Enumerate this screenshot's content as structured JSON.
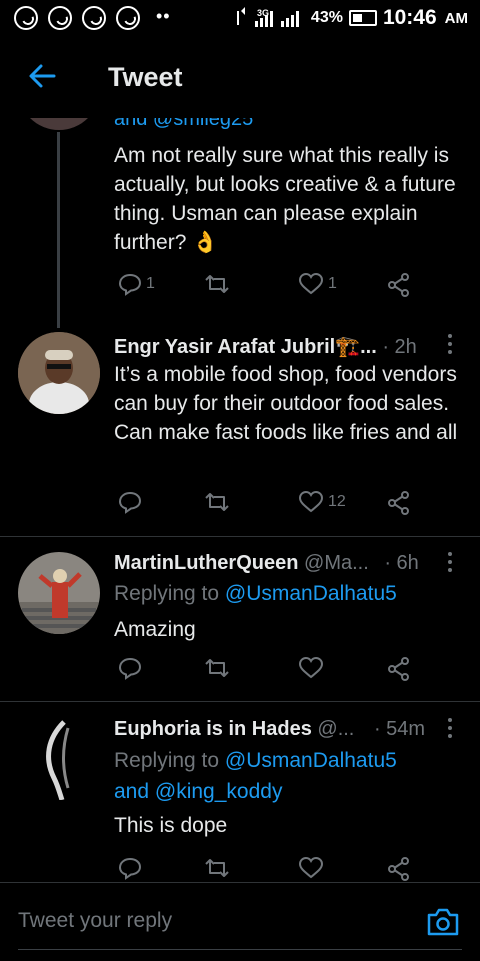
{
  "status_bar": {
    "battery_percent": "43%",
    "time": "10:46",
    "ampm": "AM",
    "overflow": "••",
    "network": "3G"
  },
  "header": {
    "title": "Tweet"
  },
  "tweets": [
    {
      "reply_partial": "and @smileg25",
      "text": "Am not really sure what this really is actually, but looks creative & a future thing. Usman can please explain further? 👌",
      "replies": "1",
      "likes": "1"
    },
    {
      "name": "Engr Yasir Arafat Jubril🏗️...",
      "time": "· 2h",
      "text": "It’s a mobile food shop, food vendors can buy for their outdoor food sales. Can make fast foods like fries and all",
      "replies": "",
      "likes": "12"
    },
    {
      "name": "MartinLutherQueen",
      "handle": "@Ma...",
      "time": "· 6h",
      "replying_label": "Replying to",
      "replying_to": "@UsmanDalhatu5",
      "text": "Amazing",
      "likes": ""
    },
    {
      "name": "Euphoria is in Hades",
      "handle": "@...",
      "time": "· 54m",
      "replying_label": "Replying to",
      "replying_to": "@UsmanDalhatu5",
      "replying_and": "and",
      "replying_to_2": "@king_koddy",
      "text": "This is dope",
      "likes": ""
    }
  ],
  "reply_bar": {
    "placeholder": "Tweet your reply"
  },
  "icons": {
    "reply": "reply-icon",
    "retweet": "retweet-icon",
    "like": "heart-icon",
    "share": "share-icon",
    "back": "back-arrow-icon",
    "camera": "camera-icon"
  },
  "colors": {
    "accent": "#1d9bf0",
    "background": "#000000",
    "secondary_text": "#71767b"
  }
}
